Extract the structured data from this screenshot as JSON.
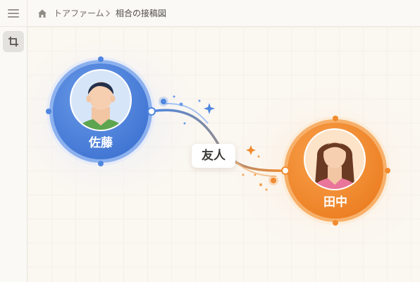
{
  "header": {
    "breadcrumb": [
      {
        "label": "トアファーム"
      },
      {
        "label": "相合の接稿図"
      }
    ]
  },
  "sidebar": {
    "tools": [
      {
        "icon": "crop-icon",
        "active": true
      }
    ]
  },
  "diagram": {
    "nodes": [
      {
        "name": "佐藤",
        "avatar": "male-person-avatar",
        "color": "#4f86df"
      },
      {
        "name": "田中",
        "avatar": "female-person-avatar",
        "color": "#f28a2e"
      }
    ],
    "relationship": {
      "label": "友人"
    }
  },
  "colors": {
    "background": "#fbf7f1",
    "node_a": "#4f86df",
    "node_b": "#f28a2e"
  }
}
